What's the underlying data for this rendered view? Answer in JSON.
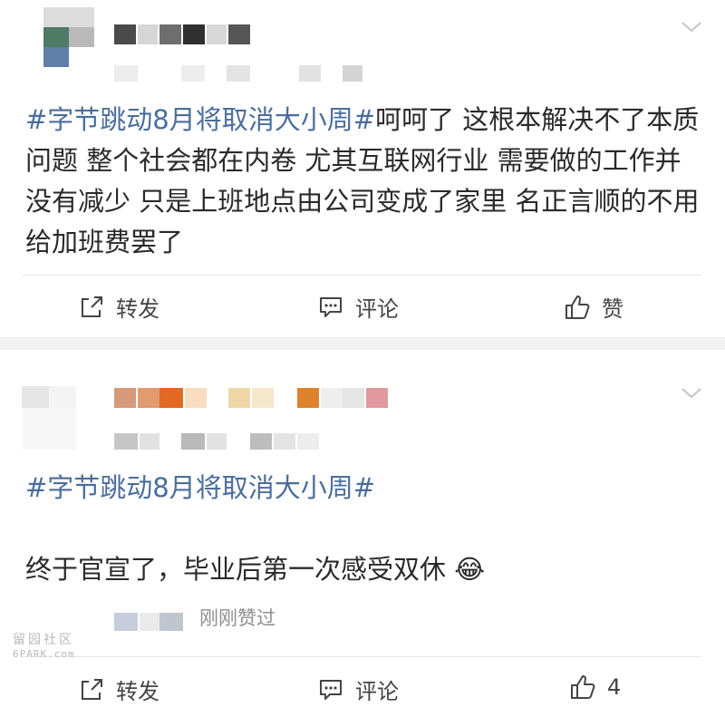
{
  "feed": {
    "posts": [
      {
        "topic": "#字节跳动8月将取消大小周#",
        "body": "呵呵了 这根本解决不了本质问题 整个社会都在内卷 尤其互联网行业 需要做的工作并没有减少 只是上班地点由公司变成了家里 名正言顺的不用给加班费罢了",
        "actions": {
          "repost": "转发",
          "comment": "评论",
          "like": "赞"
        }
      },
      {
        "topic": "#字节跳动8月将取消大小周#",
        "body": "终于官宣了，毕业后第一次感受双休",
        "emoji": "😂",
        "liked_status": "刚刚赞过",
        "actions": {
          "repost": "转发",
          "comment": "评论",
          "like_count": "4"
        }
      }
    ]
  },
  "watermark": {
    "line1": "留园社区",
    "line2": "6PARK.com"
  },
  "icons": [
    "chevron-down-icon",
    "repost-icon",
    "comment-icon",
    "thumbs-up-icon",
    "laughing-emoji-icon"
  ],
  "colors": {
    "topic": "#4b6d9c",
    "text": "#2a2a2a",
    "muted": "#8e8e8e",
    "separator": "#f2f2f2"
  }
}
